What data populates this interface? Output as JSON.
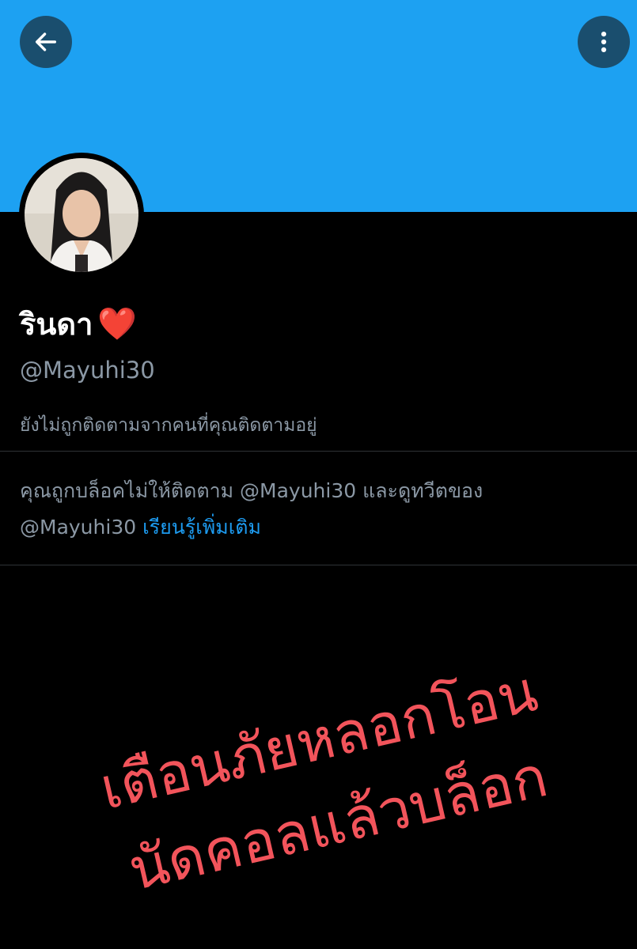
{
  "header": {
    "back_icon": "arrow-left-icon",
    "more_icon": "vertical-ellipsis-icon",
    "banner_color": "#1da1f2"
  },
  "profile": {
    "display_name": "รินดา",
    "name_emoji": "❤️",
    "handle": "@Mayuhi30",
    "follow_status": "ยังไม่ถูกติดตามจากคนที่คุณติดตามอยู่"
  },
  "block_notice": {
    "line1": "คุณถูกบล็อคไม่ให้ติดตาม @Mayuhi30 และดูทวีตของ",
    "line2_handle": "@Mayuhi30",
    "learn_more": "เรียนรู้เพิ่มเติม",
    "link_color": "#1d9bf0"
  },
  "overlay": {
    "line1": "เตือนภัยหลอกโอน",
    "line2": "นัดคอลแล้วบล็อก",
    "color": "#f2545b"
  }
}
